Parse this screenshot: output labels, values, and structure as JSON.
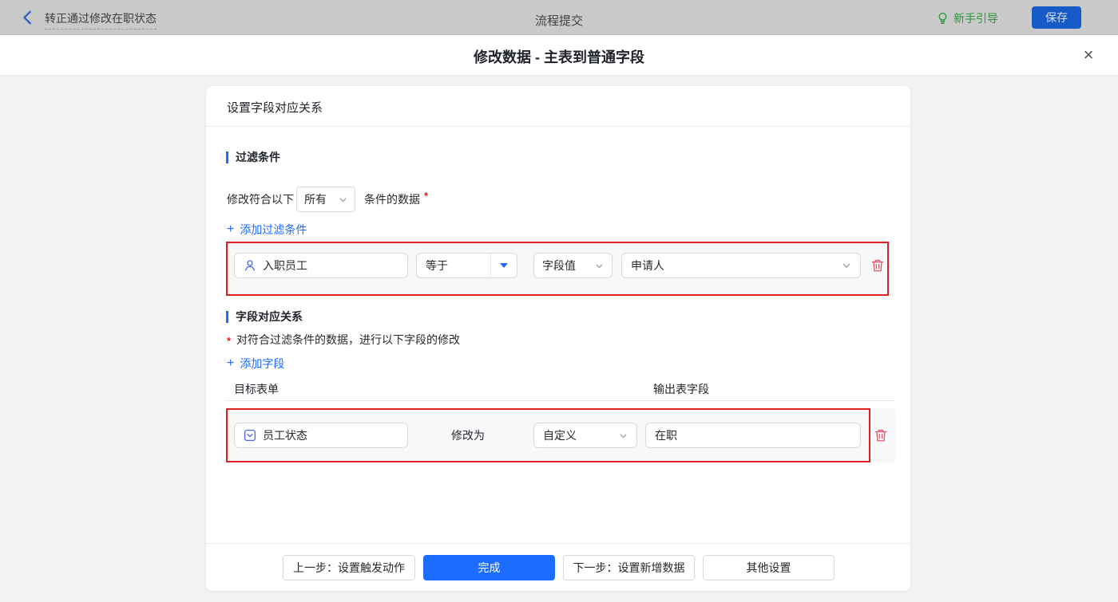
{
  "colors": {
    "accent_blue": "#1b6cff",
    "link_blue": "#1f6aff",
    "annotation_red": "#e01f1f",
    "guide_green": "#2f9440",
    "trash_pink": "#e2566b",
    "field_icon_blue": "#4d66e6"
  },
  "topbar": {
    "title": "转正通过修改在职状态",
    "center_title": "流程提交",
    "guide_label": "新手引导",
    "save_label": "保存"
  },
  "modal": {
    "title": "修改数据 - 主表到普通字段",
    "close_glyph": "×"
  },
  "panel": {
    "header": "设置字段对应关系",
    "filter": {
      "section_title": "过滤条件",
      "match_prefix": "修改符合以下",
      "match_value": "所有",
      "match_suffix": "条件的数据",
      "required_mark": "*",
      "plus": "+",
      "add_label": "添加过滤条件",
      "row": {
        "field": "入职员工",
        "operator": "等于",
        "value_type": "字段值",
        "value": "申请人"
      }
    },
    "mapping": {
      "section_title": "字段对应关系",
      "required_mark": "*",
      "desc": "对符合过滤条件的数据，进行以下字段的修改",
      "plus": "+",
      "add_label": "添加字段",
      "col_target": "目标表单",
      "col_output": "输出表字段",
      "row": {
        "field": "员工状态",
        "action": "修改为",
        "mode": "自定义",
        "value": "在职"
      }
    },
    "footer": {
      "prev_label": "上一步：设置触发动作",
      "done_label": "完成",
      "next_label": "下一步：设置新增数据",
      "other_label": "其他设置"
    }
  }
}
